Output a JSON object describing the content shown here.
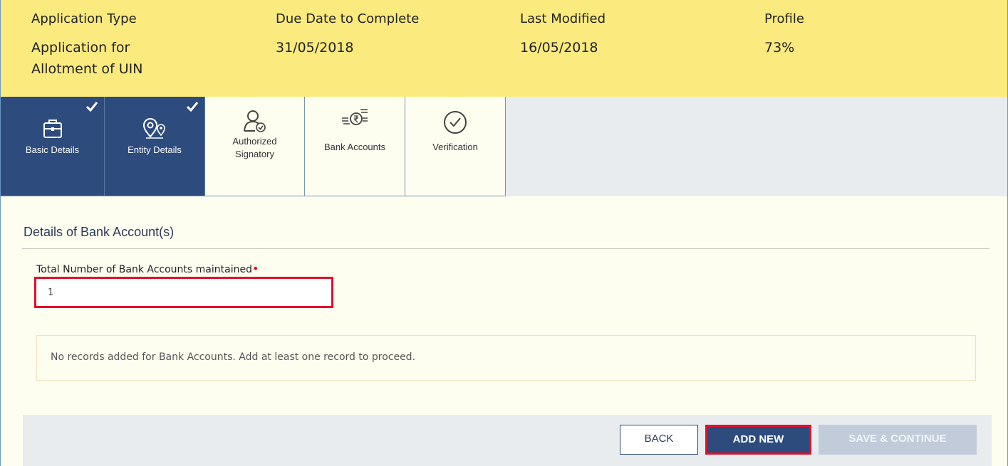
{
  "header": {
    "app_type_label": "Application Type",
    "app_type_value_line1": "Application for",
    "app_type_value_line2": "Allotment of UIN",
    "due_label": "Due Date to Complete",
    "due_value": "31/05/2018",
    "modified_label": "Last Modified",
    "modified_value": "16/05/2018",
    "profile_label": "Profile",
    "profile_value": "73%"
  },
  "tabs": [
    {
      "label": "Basic Details",
      "icon": "briefcase-icon",
      "completed": true
    },
    {
      "label": "Entity Details",
      "icon": "location-pin-icon",
      "completed": true
    },
    {
      "label_line1": "Authorized",
      "label_line2": "Signatory",
      "icon": "signatory-icon",
      "completed": false
    },
    {
      "label": "Bank Accounts",
      "icon": "bank-rupee-icon",
      "completed": false
    },
    {
      "label": "Verification",
      "icon": "check-circle-icon",
      "completed": false
    }
  ],
  "main": {
    "section_title": "Details of Bank Account(s)",
    "field_label": "Total Number of Bank Accounts maintained",
    "field_value": "1",
    "notice": "No records added for Bank Accounts. Add at least one record to proceed."
  },
  "buttons": {
    "back": "BACK",
    "add_new": "ADD NEW",
    "save_continue": "SAVE & CONTINUE"
  },
  "colors": {
    "header_bg": "#fbeb7f",
    "tab_done_bg": "#2d4b7c",
    "highlight": "#e0112b",
    "panel_bg": "#fdfdf0"
  }
}
